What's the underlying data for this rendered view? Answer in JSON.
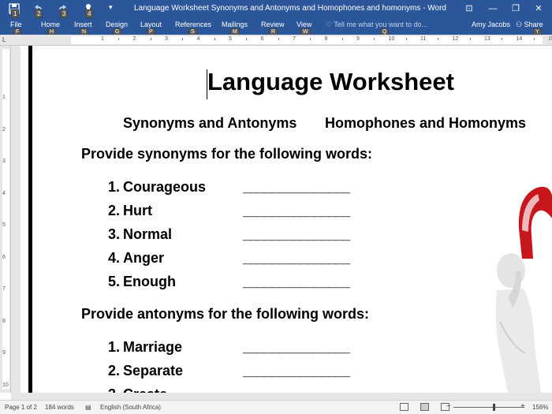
{
  "window": {
    "title": "Language Worksheet Synonyms and Antonyms and Homophones and homonyms - Word",
    "user": "Amy Jacobs",
    "share_label": "Share",
    "share_keytip": "Y",
    "minimize": "—",
    "restore": "❐",
    "close": "✕",
    "ribbon_display": "⊡"
  },
  "qat": [
    {
      "icon": "save-icon",
      "keytip": "1"
    },
    {
      "icon": "undo-icon",
      "keytip": "2"
    },
    {
      "icon": "redo-icon",
      "keytip": "3"
    },
    {
      "icon": "touch-mode-icon",
      "keytip": "4"
    }
  ],
  "ribbon": {
    "tabs": [
      {
        "label": "File",
        "keytip": "F"
      },
      {
        "label": "Home",
        "keytip": "H"
      },
      {
        "label": "Insert",
        "keytip": "N"
      },
      {
        "label": "Design",
        "keytip": "G"
      },
      {
        "label": "Layout",
        "keytip": "P"
      },
      {
        "label": "References",
        "keytip": "S"
      },
      {
        "label": "Mailings",
        "keytip": "M"
      },
      {
        "label": "Review",
        "keytip": "R"
      },
      {
        "label": "View",
        "keytip": "W"
      }
    ],
    "tell_me": "Tell me what you want to do...",
    "tell_me_keytip": "Q"
  },
  "ruler": {
    "numbers": [
      "1",
      "2",
      "3",
      "4",
      "5",
      "6",
      "7",
      "8",
      "9",
      "10",
      "11",
      "12",
      "13",
      "14",
      "15"
    ],
    "vertical_numbers": [
      "1",
      "2",
      "3",
      "4",
      "5",
      "6",
      "7",
      "8",
      "9",
      "10"
    ]
  },
  "document": {
    "title": "Language Worksheet",
    "subtitle_left": "Synonyms and Antonyms",
    "subtitle_right": "Homophones and Homonyms",
    "section1_heading": "Provide synonyms for the following words:",
    "section1_items": [
      {
        "num": "1.",
        "word": "Courageous",
        "blank": "_______________"
      },
      {
        "num": "2.",
        "word": "Hurt",
        "blank": "_______________"
      },
      {
        "num": "3.",
        "word": "Normal",
        "blank": "_______________"
      },
      {
        "num": "4.",
        "word": "Anger",
        "blank": "_______________"
      },
      {
        "num": "5.",
        "word": "Enough",
        "blank": "_______________"
      }
    ],
    "section2_heading": "Provide antonyms for the following words:",
    "section2_items": [
      {
        "num": "1.",
        "word": "Marriage",
        "blank": "_______________"
      },
      {
        "num": "2.",
        "word": "Separate",
        "blank": "_______________"
      },
      {
        "num": "3.",
        "word": "Create",
        "blank": "_______________"
      }
    ]
  },
  "statusbar": {
    "page": "Page 1 of 2",
    "words": "184 words",
    "language": "English (South Africa)",
    "zoom": "156%",
    "zoom_minus": "−",
    "zoom_plus": "+"
  },
  "colors": {
    "accent": "#2b579a",
    "art_red": "#c8161d"
  }
}
